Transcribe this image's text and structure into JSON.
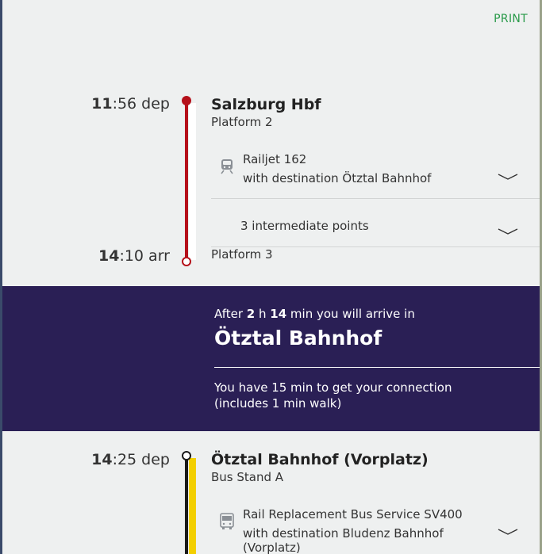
{
  "print_label": "PRINT",
  "leg1": {
    "dep_hour": "11",
    "dep_rest": ":56 dep",
    "from_station": "Salzburg Hbf",
    "from_platform": "Platform 2",
    "service_name": "Railjet 162",
    "service_destination": "with destination Ötztal Bahnhof",
    "intermediate_label": "3 intermediate points",
    "arr_hour": "14",
    "arr_rest": ":10 arr",
    "to_platform": "Platform 3",
    "line_color": "#b5101a",
    "vehicle_icon": "train-icon"
  },
  "transfer": {
    "after_prefix": "After ",
    "hours": "2",
    "hours_unit": " h ",
    "minutes": "14",
    "after_suffix": " min you will arrive in",
    "destination": "Ötztal Bahnhof",
    "connection_line1": "You have 15 min to get your connection",
    "connection_line2": "(includes 1 min walk)",
    "background_color": "#2a1f55"
  },
  "leg2": {
    "dep_hour": "14",
    "dep_rest": ":25 dep",
    "from_station": "Ötztal Bahnhof (Vorplatz)",
    "from_stand": "Bus Stand A",
    "service_name": "Rail Replacement Bus Service SV400",
    "service_destination_1": "with destination Bludenz Bahnhof",
    "service_destination_2": "(Vorplatz)",
    "line_color": "#f3cf00",
    "vehicle_icon": "bus-icon"
  }
}
